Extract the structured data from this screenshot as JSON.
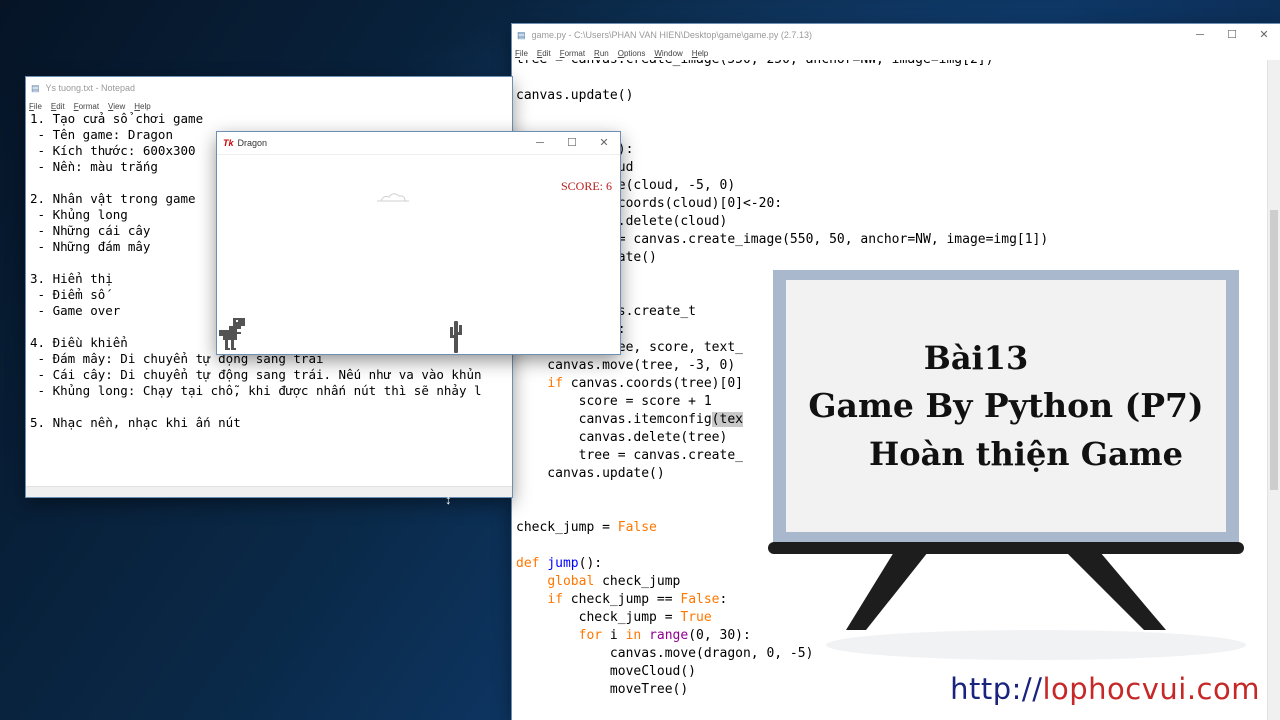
{
  "idle": {
    "title": "game.py - C:\\Users\\PHAN VAN HIEN\\Desktop\\game\\game.py (2.7.13)",
    "menus": [
      "File",
      "Edit",
      "Format",
      "Run",
      "Options",
      "Window",
      "Help"
    ]
  },
  "notepad": {
    "title": "Ys tuong.txt - Notepad",
    "menus": [
      "File",
      "Edit",
      "Format",
      "View",
      "Help"
    ],
    "lines": [
      "1. Tạo cửa sổ chơi game",
      " - Tên game: Dragon",
      " - Kích thước: 600x300",
      " - Nền: màu trắng",
      "",
      "2. Nhân vật trong game",
      " - Khủng long",
      " - Những cái cây",
      " - Những đám mây",
      "",
      "3. Hiển thị",
      " - Điểm số",
      " - Game over",
      "",
      "4. Điều khiển",
      " - Đám mây: Di chuyển tự động sang trái",
      " - Cái cây: Di chuyển tự động sang trái. Nếu như va vào khủn",
      " - Khủng long: Chạy tại chỗ, khi được nhấn nút thì sẽ nhảy l",
      "",
      "5. Nhạc nền, nhạc khi ấn nút"
    ]
  },
  "dragon": {
    "title": "Dragon",
    "tk_icon": "Tk",
    "score_text": "SCORE: 6"
  },
  "board": {
    "line1": "Bài13",
    "line2": "Game By Python (P7)",
    "line3": "Hoàn thiện Game"
  },
  "watermark": {
    "part1": "http://",
    "part2": "lophocvui.com"
  },
  "icons": {
    "minimize": "minimize-icon",
    "maximize": "maximize-icon",
    "close": "close-icon",
    "resize_cursor": "resize-cursor-icon"
  },
  "glyphs": {
    "minimize": "─",
    "maximize": "☐",
    "close": "✕",
    "resize": "↕"
  }
}
